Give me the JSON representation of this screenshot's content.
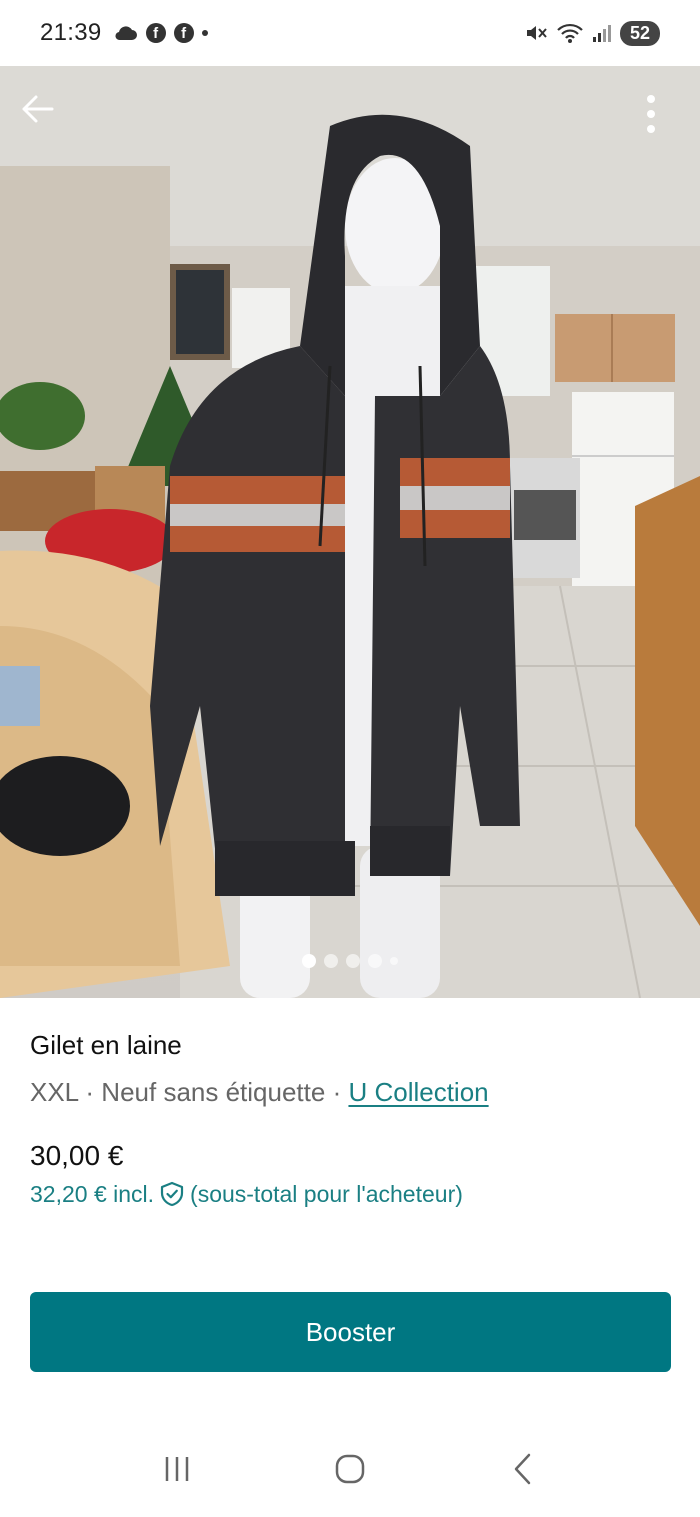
{
  "status_bar": {
    "time": "21:39",
    "battery": "52",
    "left_icons": [
      "cloud-icon",
      "facebook-icon",
      "facebook-icon",
      "dot-icon"
    ],
    "right_icons": [
      "mute-icon",
      "wifi-icon",
      "signal-icon",
      "battery-icon"
    ]
  },
  "header": {
    "back_icon": "arrow-left-icon",
    "menu_icon": "more-vertical-icon"
  },
  "carousel": {
    "count": 5,
    "active_index": 0
  },
  "item": {
    "title": "Gilet en laine",
    "size": "XXL",
    "separator1": " · ",
    "condition": "Neuf sans étiquette",
    "separator2": " · ",
    "brand": "U Collection",
    "price": "30,00 €",
    "total_price": "32,20 €  incl.",
    "total_note": "(sous-total pour l'acheteur)"
  },
  "actions": {
    "booster_label": "Booster"
  },
  "colors": {
    "accent": "#007782",
    "link": "#1a7f83"
  }
}
